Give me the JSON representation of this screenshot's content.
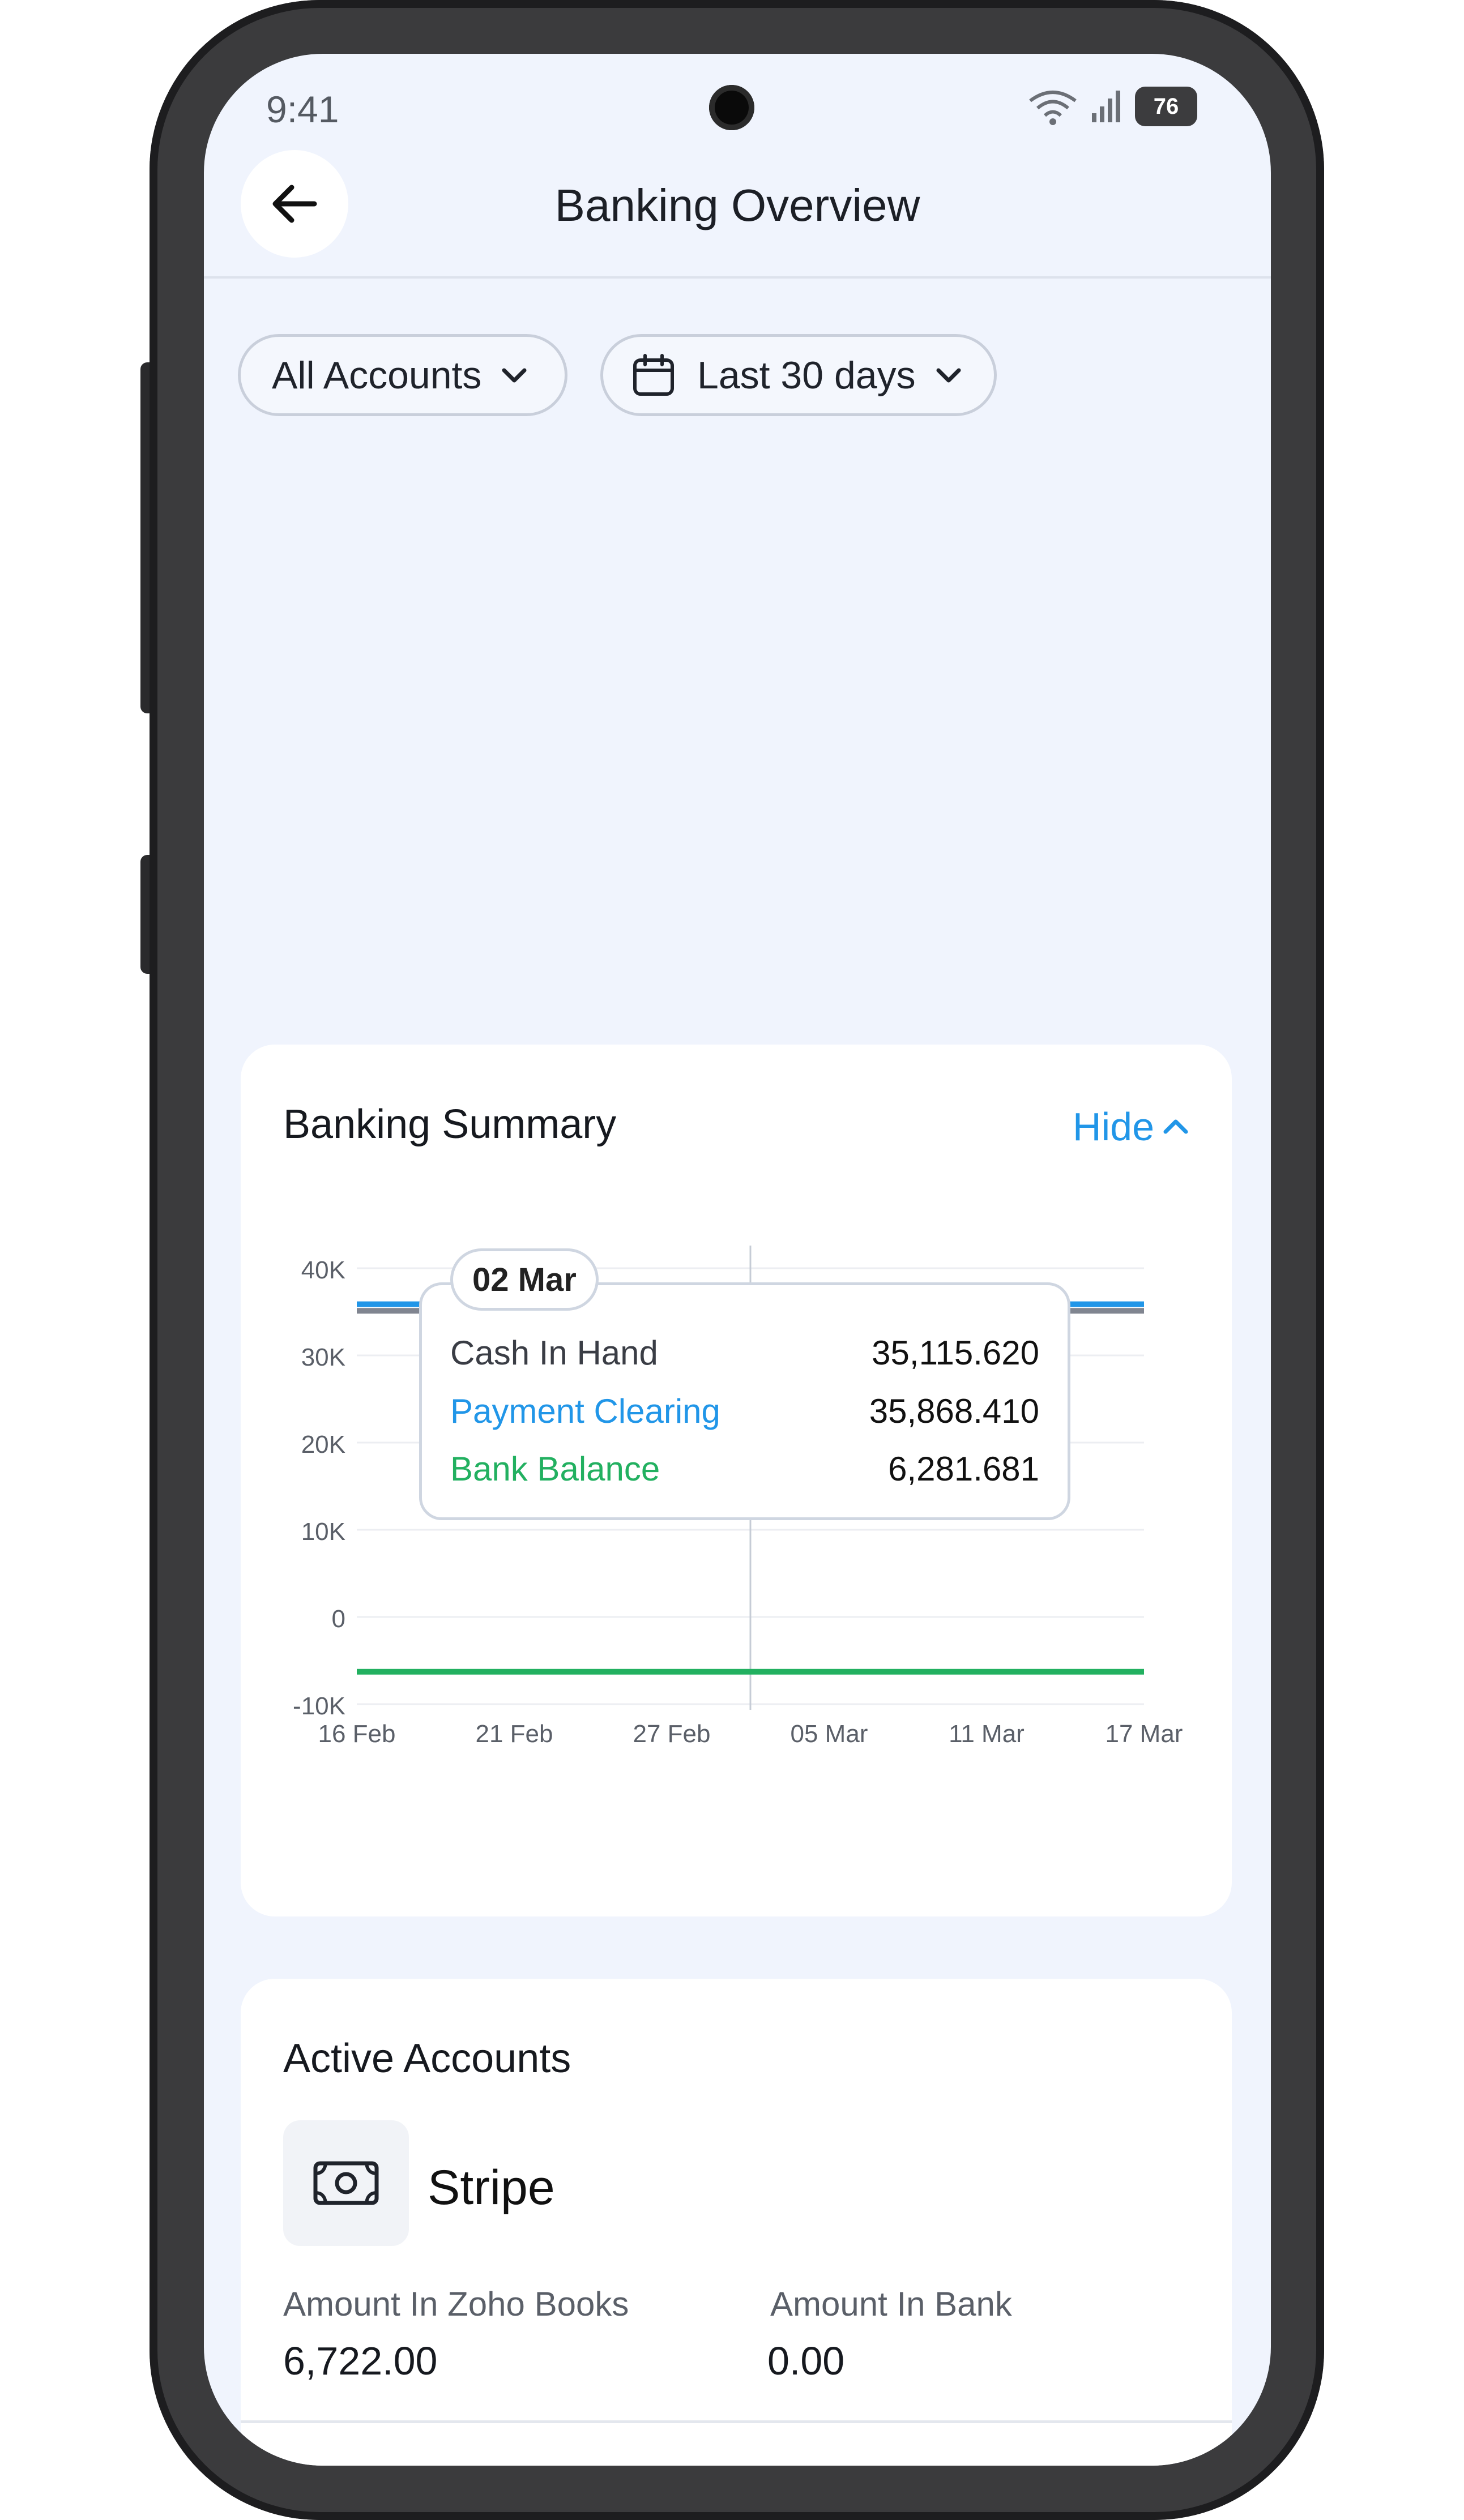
{
  "status_bar": {
    "time": "9:41",
    "battery": "76"
  },
  "header": {
    "title": "Banking Overview"
  },
  "filters": {
    "account": "All Accounts",
    "period": "Last 30 days"
  },
  "summary": {
    "title": "Banking Summary",
    "toggle_label": "Hide",
    "tooltip": {
      "date": "02 Mar",
      "rows": [
        {
          "label": "Cash In Hand",
          "value": "35,115.620",
          "color": "#3a3d45"
        },
        {
          "label": "Payment Clearing",
          "value": "35,868.410",
          "color": "#2196e8"
        },
        {
          "label": "Bank Balance",
          "value": "6,281.681",
          "color": "#22b060"
        }
      ]
    }
  },
  "chart_data": {
    "type": "line",
    "x": [
      "16 Feb",
      "21 Feb",
      "27 Feb",
      "05 Mar",
      "11 Mar",
      "17 Mar"
    ],
    "y_ticks": [
      "40K",
      "30K",
      "20K",
      "10K",
      "0",
      "-10K"
    ],
    "ylim": [
      -10000,
      40000
    ],
    "series": [
      {
        "name": "Cash In Hand",
        "color": "#808590",
        "values": [
          35115.62,
          35115.62,
          35115.62,
          35115.62,
          35115.62,
          35115.62
        ]
      },
      {
        "name": "Payment Clearing",
        "color": "#2196e8",
        "values": [
          35868.41,
          35868.41,
          35868.41,
          35868.41,
          35868.41,
          35868.41
        ]
      },
      {
        "name": "Bank Balance",
        "color": "#22b060",
        "values": [
          -6281.681,
          -6281.681,
          -6281.681,
          -6281.681,
          -6281.681,
          -6281.681
        ]
      }
    ],
    "tooltip_x": "02 Mar",
    "grid": true
  },
  "active_accounts": {
    "title": "Active Accounts",
    "items": [
      {
        "name": "Stripe",
        "icon": "cash-icon",
        "amount_books_label": "Amount In Zoho Books",
        "amount_books": "6,722.00",
        "amount_bank_label": "Amount In Bank",
        "amount_bank": "0.00"
      }
    ]
  }
}
